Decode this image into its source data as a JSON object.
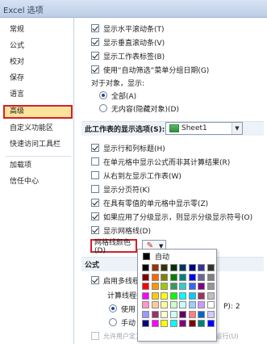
{
  "window": {
    "title": "Excel 选项"
  },
  "sidebar": {
    "items": [
      {
        "label": "常规",
        "selected": false
      },
      {
        "label": "公式",
        "selected": false
      },
      {
        "label": "校对",
        "selected": false
      },
      {
        "label": "保存",
        "selected": false
      },
      {
        "label": "语言",
        "selected": false
      },
      {
        "label": "高级",
        "selected": true
      },
      {
        "label": "自定义功能区",
        "selected": false
      },
      {
        "label": "快速访问工具栏",
        "selected": false
      },
      {
        "label": "加载项",
        "selected": false
      },
      {
        "label": "信任中心",
        "selected": false
      }
    ]
  },
  "top_options": [
    {
      "label": "显示水平滚动条(T)",
      "checked": true
    },
    {
      "label": "显示垂直滚动条(V)",
      "checked": true
    },
    {
      "label": "显示工作表标签(B)",
      "checked": true
    },
    {
      "label": "使用“自动筛选”菜单分组日期(G)",
      "checked": true
    }
  ],
  "objects": {
    "label": "对于对象，显示:",
    "options": [
      {
        "label": "全部(A)",
        "checked": true
      },
      {
        "label": "无内容(隐藏对象)(D)",
        "checked": false
      }
    ]
  },
  "sheet_section": {
    "header": "此工作表的显示选项(S):",
    "sheet_value": "Sheet1",
    "options": [
      {
        "label": "显示行和列标题(H)",
        "checked": true
      },
      {
        "label": "在单元格中显示公式而非其计算结果(R)",
        "checked": false
      },
      {
        "label": "从右到左显示工作表(W)",
        "checked": false
      },
      {
        "label": "显示分页符(K)",
        "checked": false
      },
      {
        "label": "在具有零值的单元格中显示零(Z)",
        "checked": true
      },
      {
        "label": "如果应用了分级显示，则显示分级显示符号(O)",
        "checked": true
      },
      {
        "label": "显示网格线(D)",
        "checked": true
      }
    ],
    "gridline_color_label": "网格线颜色(D)"
  },
  "formula_section": {
    "header": "公式",
    "multithread_label": "启用多线程计",
    "threads_label": "计算线程数",
    "use_label": "使用",
    "manual_label": "手动",
    "processor_value": "P): 2",
    "xll_label": "允许用户定义的 XLL 函数在计算群集上运行(U)"
  },
  "palette": {
    "auto_label": "自动",
    "auto_color": "#000000",
    "colors": [
      "#000000",
      "#993300",
      "#333300",
      "#003300",
      "#003366",
      "#000080",
      "#333399",
      "#333333",
      "#800000",
      "#ff6600",
      "#808000",
      "#008000",
      "#008080",
      "#0000ff",
      "#666699",
      "#808080",
      "#ff0000",
      "#ff9900",
      "#99cc00",
      "#339966",
      "#33cccc",
      "#3366ff",
      "#800080",
      "#969696",
      "#ff00ff",
      "#ffcc00",
      "#ffff00",
      "#00ff00",
      "#00ffff",
      "#00ccff",
      "#993366",
      "#c0c0c0",
      "#ff99cc",
      "#ffcc99",
      "#ffff99",
      "#ccffcc",
      "#ccffff",
      "#99ccff",
      "#cc99ff",
      "#ffffff",
      "#9999ff",
      "#993366",
      "#ffffcc",
      "#ccffff",
      "#660066",
      "#ff8080",
      "#0066cc",
      "#ccccff",
      "#000080",
      "#ff00ff",
      "#ffff00",
      "#00ffff",
      "#800080",
      "#800000",
      "#008080",
      "#0000ff"
    ]
  },
  "colors": {
    "highlight_border": "#d32028",
    "selected_bg": "#fbe39c",
    "gridline_pen": "#d01010"
  }
}
